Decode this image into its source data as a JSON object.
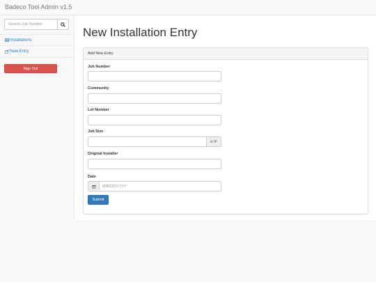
{
  "app": {
    "title": "Badeco Tool Admin v1.5"
  },
  "sidebar": {
    "search": {
      "placeholder": "Search Job Number",
      "icon": "search-icon"
    },
    "items": [
      {
        "label": "Installations",
        "icon": "table-icon"
      },
      {
        "label": "New Entry",
        "icon": "edit-icon"
      }
    ],
    "signout_label": "Sign Out"
  },
  "main": {
    "title": "New Installation Entry",
    "panel": {
      "heading": "Add New Entry",
      "fields": {
        "job_number": {
          "label": "Job Number",
          "value": ""
        },
        "community": {
          "label": "Community",
          "value": ""
        },
        "lot_number": {
          "label": "Lot Number",
          "value": ""
        },
        "job_size": {
          "label": "Job Size",
          "value": "",
          "addon": "in ft²"
        },
        "original_installer": {
          "label": "Original Installer",
          "value": ""
        },
        "date": {
          "label": "Date",
          "placeholder": "MM/DD/YYYY",
          "icon": "calendar-icon"
        }
      },
      "submit_label": "Submit"
    }
  },
  "colors": {
    "accent": "#337ab7",
    "danger": "#d9534f",
    "link": "#337ab7"
  }
}
